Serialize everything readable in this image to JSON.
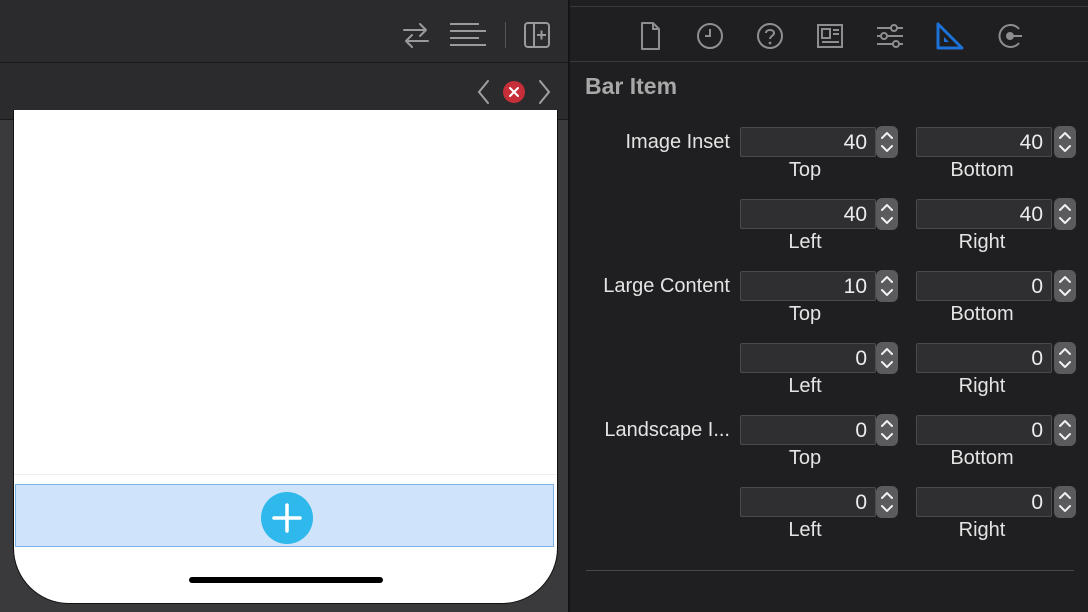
{
  "inspector": {
    "section_title": "Bar Item",
    "groups": [
      {
        "label": "Image Inset",
        "rows": [
          {
            "a": {
              "value": "40",
              "label": "Top"
            },
            "b": {
              "value": "40",
              "label": "Bottom"
            }
          },
          {
            "a": {
              "value": "40",
              "label": "Left"
            },
            "b": {
              "value": "40",
              "label": "Right"
            }
          }
        ]
      },
      {
        "label": "Large Content",
        "rows": [
          {
            "a": {
              "value": "10",
              "label": "Top"
            },
            "b": {
              "value": "0",
              "label": "Bottom"
            }
          },
          {
            "a": {
              "value": "0",
              "label": "Left"
            },
            "b": {
              "value": "0",
              "label": "Right"
            }
          }
        ]
      },
      {
        "label": "Landscape I...",
        "rows": [
          {
            "a": {
              "value": "0",
              "label": "Top"
            },
            "b": {
              "value": "0",
              "label": "Bottom"
            }
          },
          {
            "a": {
              "value": "0",
              "label": "Left"
            },
            "b": {
              "value": "0",
              "label": "Right"
            }
          }
        ]
      }
    ]
  },
  "icons": {
    "toolbar": [
      "swap-arrows-icon",
      "lines-icon",
      "add-editor-icon"
    ],
    "jumpbar": [
      "chevron-left-icon",
      "error-icon",
      "chevron-right-icon"
    ],
    "inspector_tabs": [
      "file-icon",
      "history-icon",
      "help-icon",
      "identity-icon",
      "attributes-icon",
      "size-icon",
      "connections-icon"
    ],
    "canvas": [
      "add-icon"
    ]
  },
  "colors": {
    "accent_selected_tab": "#1c72d8",
    "error": "#c62f39",
    "add_button": "#2fb8ec",
    "selection_fill": "#cfe4fb"
  }
}
